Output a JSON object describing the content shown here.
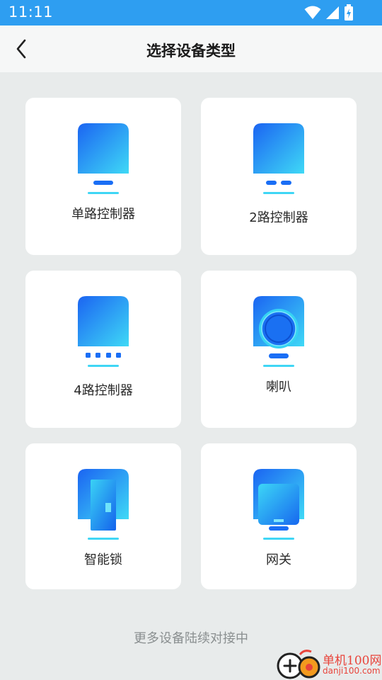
{
  "status_bar": {
    "time": "11:11"
  },
  "header": {
    "title": "选择设备类型"
  },
  "devices": [
    {
      "label": "单路控制器"
    },
    {
      "label": "2路控制器"
    },
    {
      "label": "4路控制器"
    },
    {
      "label": "喇叭"
    },
    {
      "label": "智能锁"
    },
    {
      "label": "网关"
    }
  ],
  "footer": {
    "text": "更多设备陆续对接中"
  },
  "watermark": {
    "title": "单机100网",
    "url": "danji100.com"
  },
  "colors": {
    "status_bar": "#2e9ef1",
    "accent_blue": "#1a6ef5",
    "accent_cyan": "#3fd6f5",
    "background": "#e8ebeb"
  }
}
